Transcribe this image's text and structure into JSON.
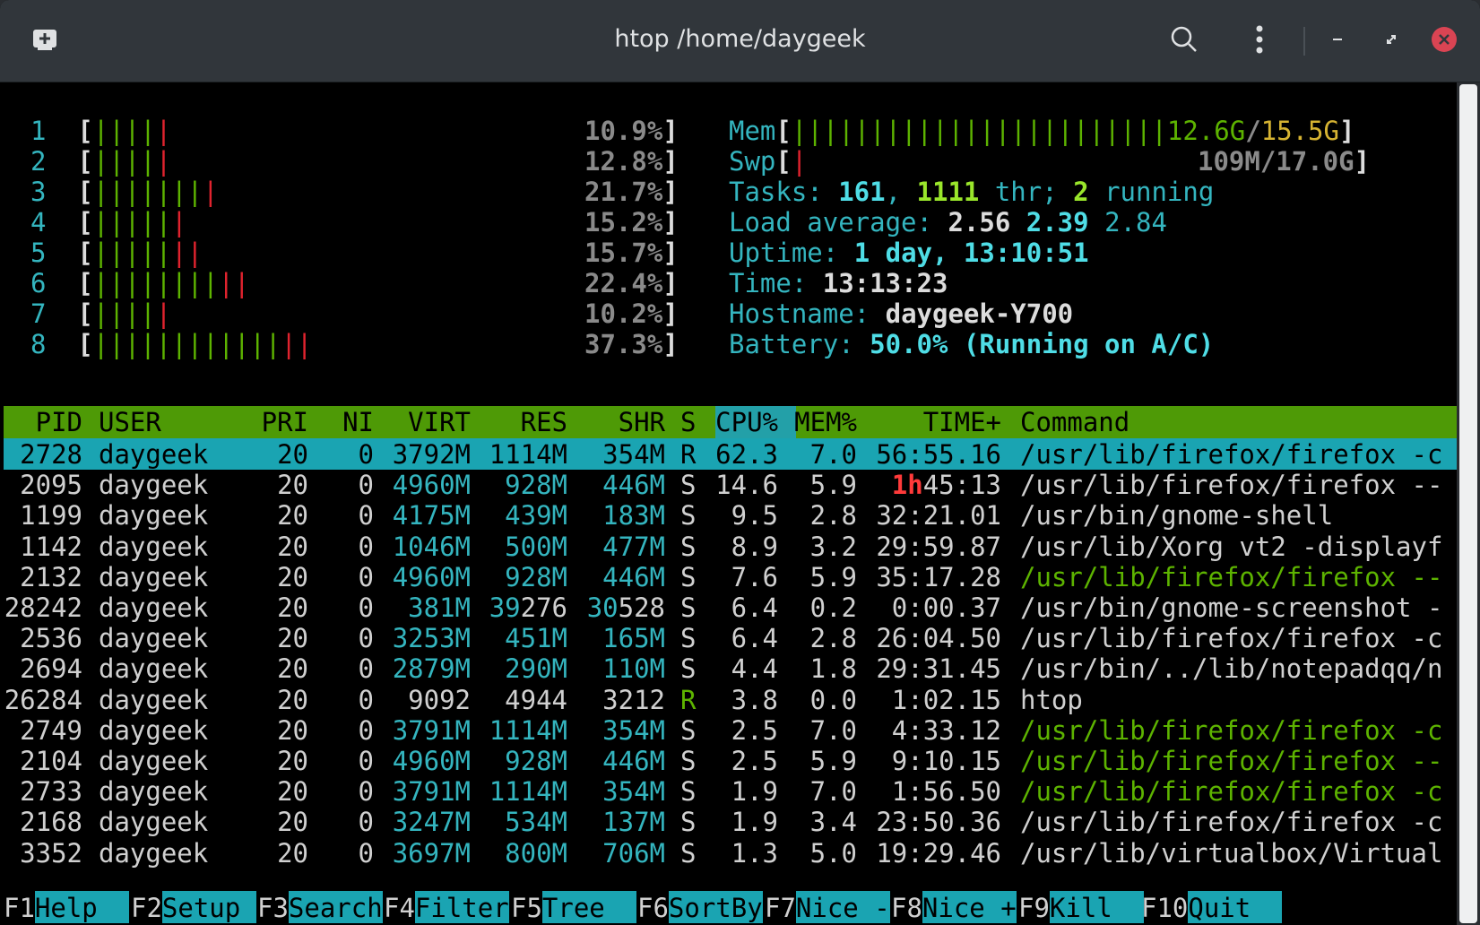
{
  "window": {
    "title": "htop /home/daygeek"
  },
  "colors": {
    "titlebar": "#31363b",
    "header_bg": "#4e9a06",
    "selected_bg": "#1aa4b2",
    "cyan": "#34b5bf",
    "green": "#5db300",
    "red": "#e0232e"
  },
  "cpus": [
    {
      "id": "1",
      "green": "||||",
      "red": "|",
      "pct": "10.9%"
    },
    {
      "id": "2",
      "green": "||||",
      "red": "|",
      "pct": "12.8%"
    },
    {
      "id": "3",
      "green": "|||||||",
      "red": "|",
      "pct": "21.7%"
    },
    {
      "id": "4",
      "green": "|||||",
      "red": "|",
      "pct": "15.2%"
    },
    {
      "id": "5",
      "green": "|||||",
      "red": "||",
      "pct": "15.7%"
    },
    {
      "id": "6",
      "green": "||||||||",
      "red": "||",
      "pct": "22.4%"
    },
    {
      "id": "7",
      "green": "||||",
      "red": "|",
      "pct": "10.2%"
    },
    {
      "id": "8",
      "green": "||||||||||||",
      "red": "||",
      "pct": "37.3%"
    }
  ],
  "meters": {
    "mem_label": "Mem",
    "mem_bar": "||||||||||||||||||||||||",
    "mem_used": "12.6G",
    "mem_total": "15.5G",
    "swp_label": "Swp",
    "swp_bar": "|",
    "swp_used": "109M/17.0G",
    "tasks_label": "Tasks: ",
    "tasks": "161",
    "thr": "1111",
    "thr_label": " thr; ",
    "running": "2",
    "running_label": " running",
    "load_label": "Load average: ",
    "load1": "2.56",
    "load5": "2.39",
    "load15": "2.84",
    "uptime_label": "Uptime: ",
    "uptime": "1 day, 13:10:51",
    "time_label": "Time: ",
    "time": "13:13:23",
    "host_label": "Hostname: ",
    "host": "daygeek-Y700",
    "battery_label": "Battery: ",
    "battery": "50.0% (Running on A/C)"
  },
  "columns": [
    "  PID",
    "USER",
    "PRI",
    "NI",
    "VIRT",
    "RES",
    "SHR",
    "S",
    "CPU%",
    "MEM%",
    "TIME+",
    "Command"
  ],
  "processes": [
    {
      "pid": "2728",
      "user": "daygeek",
      "pri": "20",
      "ni": "0",
      "virt": "3792M",
      "res": "1114M",
      "shr": "354M",
      "s": "R",
      "cpu": "62.3",
      "mem": "7.0",
      "time": "56:55.16",
      "cmd": "/usr/lib/firefox/firefox -c"
    },
    {
      "pid": "2095",
      "user": "daygeek",
      "pri": "20",
      "ni": "0",
      "virt": "4960M",
      "res": "928M",
      "shr": "446M",
      "s": "S",
      "cpu": "14.6",
      "mem": "5.9",
      "time_h": "1h",
      "time": "45:13",
      "cmd": "/usr/lib/firefox/firefox --"
    },
    {
      "pid": "1199",
      "user": "daygeek",
      "pri": "20",
      "ni": "0",
      "virt": "4175M",
      "res": "439M",
      "shr": "183M",
      "s": "S",
      "cpu": "9.5",
      "mem": "2.8",
      "time": "32:21.01",
      "cmd": "/usr/bin/gnome-shell"
    },
    {
      "pid": "1142",
      "user": "daygeek",
      "pri": "20",
      "ni": "0",
      "virt": "1046M",
      "res": "500M",
      "shr": "477M",
      "s": "S",
      "cpu": "8.9",
      "mem": "3.2",
      "time": "29:59.87",
      "cmd": "/usr/lib/Xorg vt2 -displayf"
    },
    {
      "pid": "2132",
      "user": "daygeek",
      "pri": "20",
      "ni": "0",
      "virt": "4960M",
      "res": "928M",
      "shr": "446M",
      "s": "S",
      "cpu": "7.6",
      "mem": "5.9",
      "time": "35:17.28",
      "cmd": "/usr/lib/firefox/firefox --",
      "thread": true
    },
    {
      "pid": "28242",
      "user": "daygeek",
      "pri": "20",
      "ni": "0",
      "virt": "381M",
      "res_a": "39",
      "res": "276",
      "shr_a": "30",
      "shr": "528",
      "s": "S",
      "cpu": "6.4",
      "mem": "0.2",
      "time": "0:00.37",
      "cmd": "/usr/bin/gnome-screenshot -"
    },
    {
      "pid": "2536",
      "user": "daygeek",
      "pri": "20",
      "ni": "0",
      "virt": "3253M",
      "res": "451M",
      "shr": "165M",
      "s": "S",
      "cpu": "6.4",
      "mem": "2.8",
      "time": "26:04.50",
      "cmd": "/usr/lib/firefox/firefox -c"
    },
    {
      "pid": "2694",
      "user": "daygeek",
      "pri": "20",
      "ni": "0",
      "virt": "2879M",
      "res": "290M",
      "shr": "110M",
      "s": "S",
      "cpu": "4.4",
      "mem": "1.8",
      "time": "29:31.45",
      "cmd": "/usr/bin/../lib/notepadqq/n"
    },
    {
      "pid": "26284",
      "user": "daygeek",
      "pri": "20",
      "ni": "0",
      "virt": "9092",
      "res": "4944",
      "shr": "3212",
      "s": "R",
      "cpu": "3.8",
      "mem": "0.0",
      "time": "1:02.15",
      "cmd": "htop",
      "plain": true
    },
    {
      "pid": "2749",
      "user": "daygeek",
      "pri": "20",
      "ni": "0",
      "virt": "3791M",
      "res": "1114M",
      "shr": "354M",
      "s": "S",
      "cpu": "2.5",
      "mem": "7.0",
      "time": "4:33.12",
      "cmd": "/usr/lib/firefox/firefox -c",
      "thread": true
    },
    {
      "pid": "2104",
      "user": "daygeek",
      "pri": "20",
      "ni": "0",
      "virt": "4960M",
      "res": "928M",
      "shr": "446M",
      "s": "S",
      "cpu": "2.5",
      "mem": "5.9",
      "time": "9:10.15",
      "cmd": "/usr/lib/firefox/firefox --",
      "thread": true
    },
    {
      "pid": "2733",
      "user": "daygeek",
      "pri": "20",
      "ni": "0",
      "virt": "3791M",
      "res": "1114M",
      "shr": "354M",
      "s": "S",
      "cpu": "1.9",
      "mem": "7.0",
      "time": "1:56.50",
      "cmd": "/usr/lib/firefox/firefox -c",
      "thread": true
    },
    {
      "pid": "2168",
      "user": "daygeek",
      "pri": "20",
      "ni": "0",
      "virt": "3247M",
      "res": "534M",
      "shr": "137M",
      "s": "S",
      "cpu": "1.9",
      "mem": "3.4",
      "time": "23:50.36",
      "cmd": "/usr/lib/firefox/firefox -c"
    },
    {
      "pid": "3352",
      "user": "daygeek",
      "pri": "20",
      "ni": "0",
      "virt": "3697M",
      "res": "800M",
      "shr": "706M",
      "s": "S",
      "cpu": "1.3",
      "mem": "5.0",
      "time": "19:29.46",
      "cmd": "/usr/lib/virtualbox/Virtual"
    }
  ],
  "fkeys": [
    {
      "key": "F1",
      "label": "Help  "
    },
    {
      "key": "F2",
      "label": "Setup "
    },
    {
      "key": "F3",
      "label": "Search"
    },
    {
      "key": "F4",
      "label": "Filter"
    },
    {
      "key": "F5",
      "label": "Tree  "
    },
    {
      "key": "F6",
      "label": "SortBy"
    },
    {
      "key": "F7",
      "label": "Nice -"
    },
    {
      "key": "F8",
      "label": "Nice +"
    },
    {
      "key": "F9",
      "label": "Kill  "
    },
    {
      "key": "F10",
      "label": "Quit  "
    }
  ]
}
